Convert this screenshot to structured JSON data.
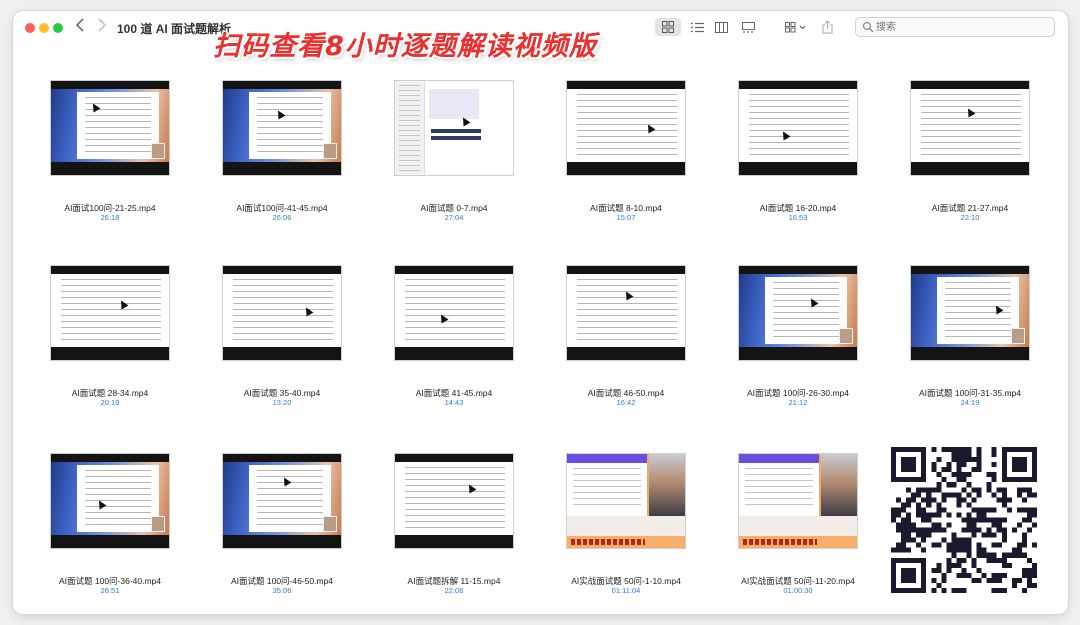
{
  "window": {
    "title": "100 道 AI 面试题解析"
  },
  "overlay": {
    "title": "扫码查看8小时逐题解读视频版"
  },
  "search": {
    "placeholder": "搜索"
  },
  "files": [
    {
      "name": "AI面试100问-21-25.mp4",
      "duration": "26:18",
      "thumb": "blue"
    },
    {
      "name": "AI面试100问-41-45.mp4",
      "duration": "26:06",
      "thumb": "blue"
    },
    {
      "name": "AI面试题 0-7.mp4",
      "duration": "27:04",
      "thumb": "doc-ai"
    },
    {
      "name": "AI面试题 8-10.mp4",
      "duration": "15:07",
      "thumb": "white"
    },
    {
      "name": "AI面试题 16-20.mp4",
      "duration": "16:53",
      "thumb": "white"
    },
    {
      "name": "AI面试题 21-27.mp4",
      "duration": "22:10",
      "thumb": "white"
    },
    {
      "name": "AI面试题 28-34.mp4",
      "duration": "20:19",
      "thumb": "white"
    },
    {
      "name": "AI面试题 35-40.mp4",
      "duration": "13:20",
      "thumb": "white"
    },
    {
      "name": "AI面试题 41-45.mp4",
      "duration": "14:43",
      "thumb": "white"
    },
    {
      "name": "AI面试题 46-50.mp4",
      "duration": "16:42",
      "thumb": "white"
    },
    {
      "name": "AI面试题 100问-26-30.mp4",
      "duration": "21:12",
      "thumb": "blue"
    },
    {
      "name": "AI面试题 100问-31-35.mp4",
      "duration": "24:19",
      "thumb": "blue"
    },
    {
      "name": "AI面试题 100问-36-40.mp4",
      "duration": "26:51",
      "thumb": "blue"
    },
    {
      "name": "AI面试题 100问-46-50.mp4",
      "duration": "35:06",
      "thumb": "blue"
    },
    {
      "name": "AI面试题拆解 11-15.mp4",
      "duration": "22:06",
      "thumb": "white"
    },
    {
      "name": "AI实战面试题 50问-1-10.mp4",
      "duration": "01:11:04",
      "thumb": "video"
    },
    {
      "name": "AI实战面试题 50问-11-20.mp4",
      "duration": "01:00:30",
      "thumb": "video"
    }
  ],
  "icons": {
    "view_grid": "grid-view-icon",
    "view_list": "list-view-icon",
    "view_columns": "columns-view-icon",
    "view_gallery": "gallery-view-icon",
    "group": "group-icon",
    "share": "share-icon",
    "search": "search-icon",
    "qr": "qr-code"
  },
  "colors": {
    "overlay_title": "#e8302e",
    "duration": "#2f7bdc"
  }
}
